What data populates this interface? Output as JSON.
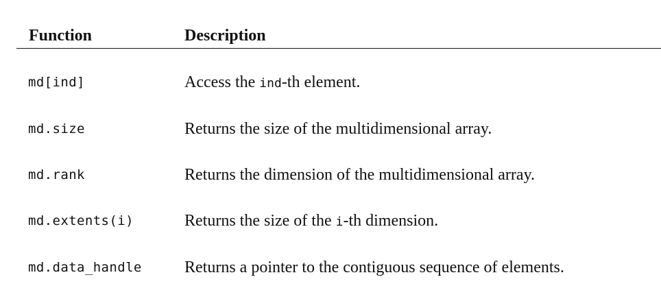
{
  "table": {
    "headers": {
      "function": "Function",
      "description": "Description"
    },
    "rows": [
      {
        "function": "md[ind]",
        "desc_before": "Access the ",
        "desc_code": "ind",
        "desc_after": "-th element."
      },
      {
        "function": "md.size",
        "desc_before": "Returns the size of the multidimensional array.",
        "desc_code": "",
        "desc_after": ""
      },
      {
        "function": "md.rank",
        "desc_before": "Returns the dimension of the multidimensional array.",
        "desc_code": "",
        "desc_after": ""
      },
      {
        "function": "md.extents(i)",
        "desc_before": "Returns the size of the ",
        "desc_code": "i",
        "desc_after": "-th dimension."
      },
      {
        "function": "md.data_handle",
        "desc_before": "Returns a pointer to the contiguous sequence of elements.",
        "desc_code": "",
        "desc_after": ""
      }
    ]
  }
}
